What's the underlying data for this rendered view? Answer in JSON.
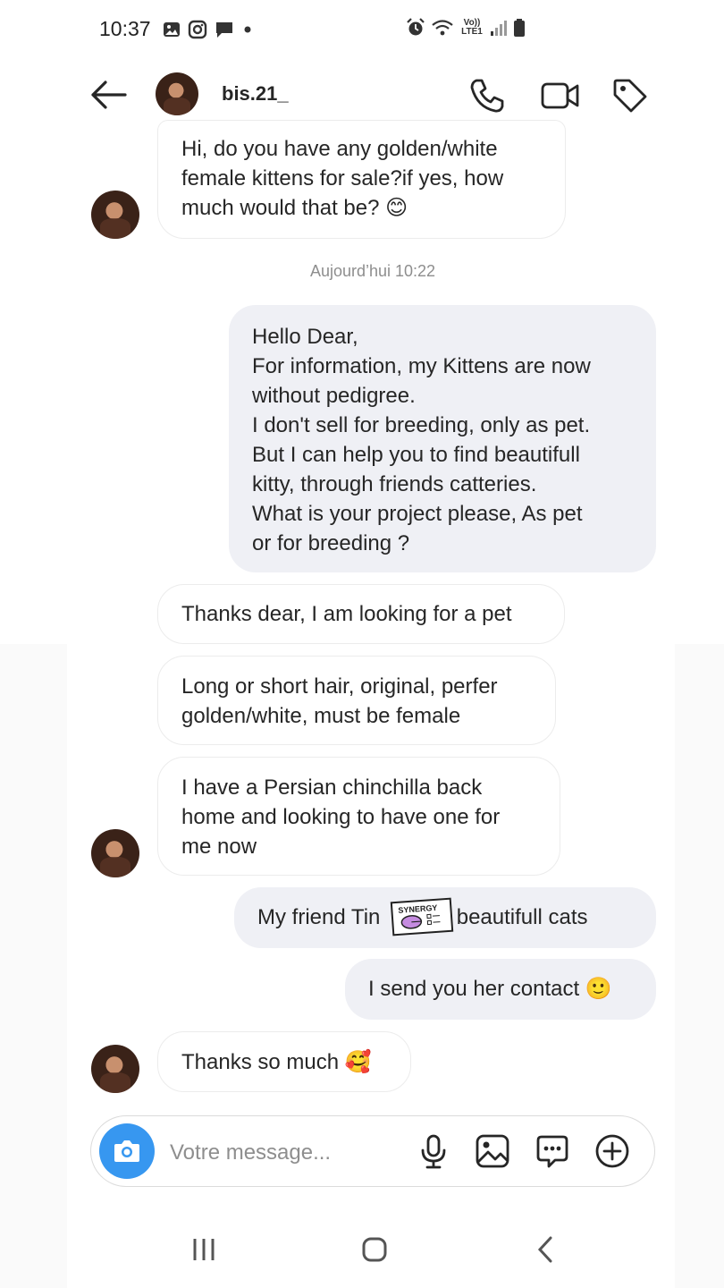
{
  "status_bar": {
    "time": "10:37",
    "network_label": "Vo)) LTE1",
    "icons_left": [
      "gallery-icon",
      "instagram-icon",
      "chat-icon",
      "dot-icon"
    ],
    "icons_right": [
      "alarm-icon",
      "wifi-icon",
      "signal-icon",
      "battery-icon"
    ]
  },
  "header": {
    "username": "bis.21_",
    "actions": [
      "phone-icon",
      "video-icon",
      "tag-icon"
    ]
  },
  "conversation": {
    "messages": [
      {
        "sender": "them",
        "text": "Hi, do you have any golden/white\nfemale kittens for sale?if yes, how\nmuch would that be? 😊"
      },
      {
        "sender": "me",
        "text": "Hello Dear,\nFor information, my Kittens are now\nwithout pedigree.\nI don't sell for breeding, only as pet.\nBut I can help you to find beautifull\nkitty, through friends catteries.\nWhat is your project please, As pet\nor for breeding ?"
      },
      {
        "sender": "them",
        "text": "Thanks dear, I am looking for a pet"
      },
      {
        "sender": "them",
        "text": "Long or short hair, original, perfer\ngolden/white, must be female"
      },
      {
        "sender": "them",
        "text": "I have a Persian chinchilla back\nhome and looking to have one for\nme now"
      },
      {
        "sender": "me",
        "text": "My friend Tin        as beautifull cats"
      },
      {
        "sender": "me",
        "text": "I send you her contact 🙂"
      },
      {
        "sender": "them",
        "text": "Thanks so much 🥰"
      }
    ],
    "timestamp": "Aujourd’hui 10:22",
    "sticker_text": "SYNERGY"
  },
  "composer": {
    "placeholder": "Votre message...",
    "icons": [
      "microphone-icon",
      "image-icon",
      "sticker-icon",
      "add-icon"
    ]
  },
  "colors": {
    "accent": "#3797f0",
    "outgoing_bubble": "#eff0f5",
    "incoming_border": "#ececec",
    "timestamp": "#8e8e8e"
  }
}
